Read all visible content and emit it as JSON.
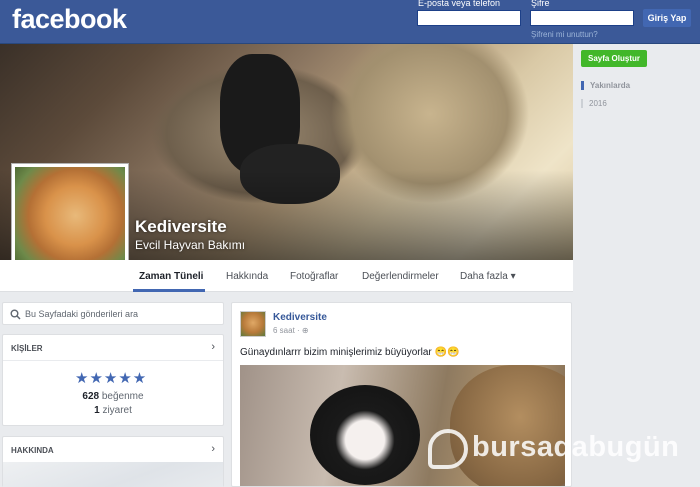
{
  "header": {
    "logo": "facebook",
    "email_label": "E-posta veya telefon",
    "password_label": "Şifre",
    "forgot_label": "Şifreni mi unuttun?",
    "login_button": "Giriş Yap"
  },
  "page": {
    "name": "Kediversite",
    "category": "Evcil Hayvan Bakımı"
  },
  "tabs": [
    "Zaman Tüneli",
    "Hakkında",
    "Fotoğraflar",
    "Değerlendirmeler",
    "Daha fazla ▾"
  ],
  "right": {
    "create_page": "Sayfa Oluştur",
    "timeline": [
      "Yakınlarda",
      "2016"
    ]
  },
  "left": {
    "search_placeholder": "Bu Sayfadaki gönderileri ara",
    "people_heading": "KİŞİLER",
    "likes_count": "628",
    "likes_label": "beğenme",
    "visits_count": "1",
    "visits_label": "ziyaret",
    "about_heading": "HAKKINDA"
  },
  "post": {
    "author": "Kediversite",
    "time": "6 saat",
    "text": "Günaydınlarrr bizim minişlerimiz büyüyorlar 😁😁"
  },
  "watermark": "bursadabugün",
  "colors": {
    "brand": "#3b5998",
    "accent": "#4267b2",
    "create": "#42b72a"
  }
}
